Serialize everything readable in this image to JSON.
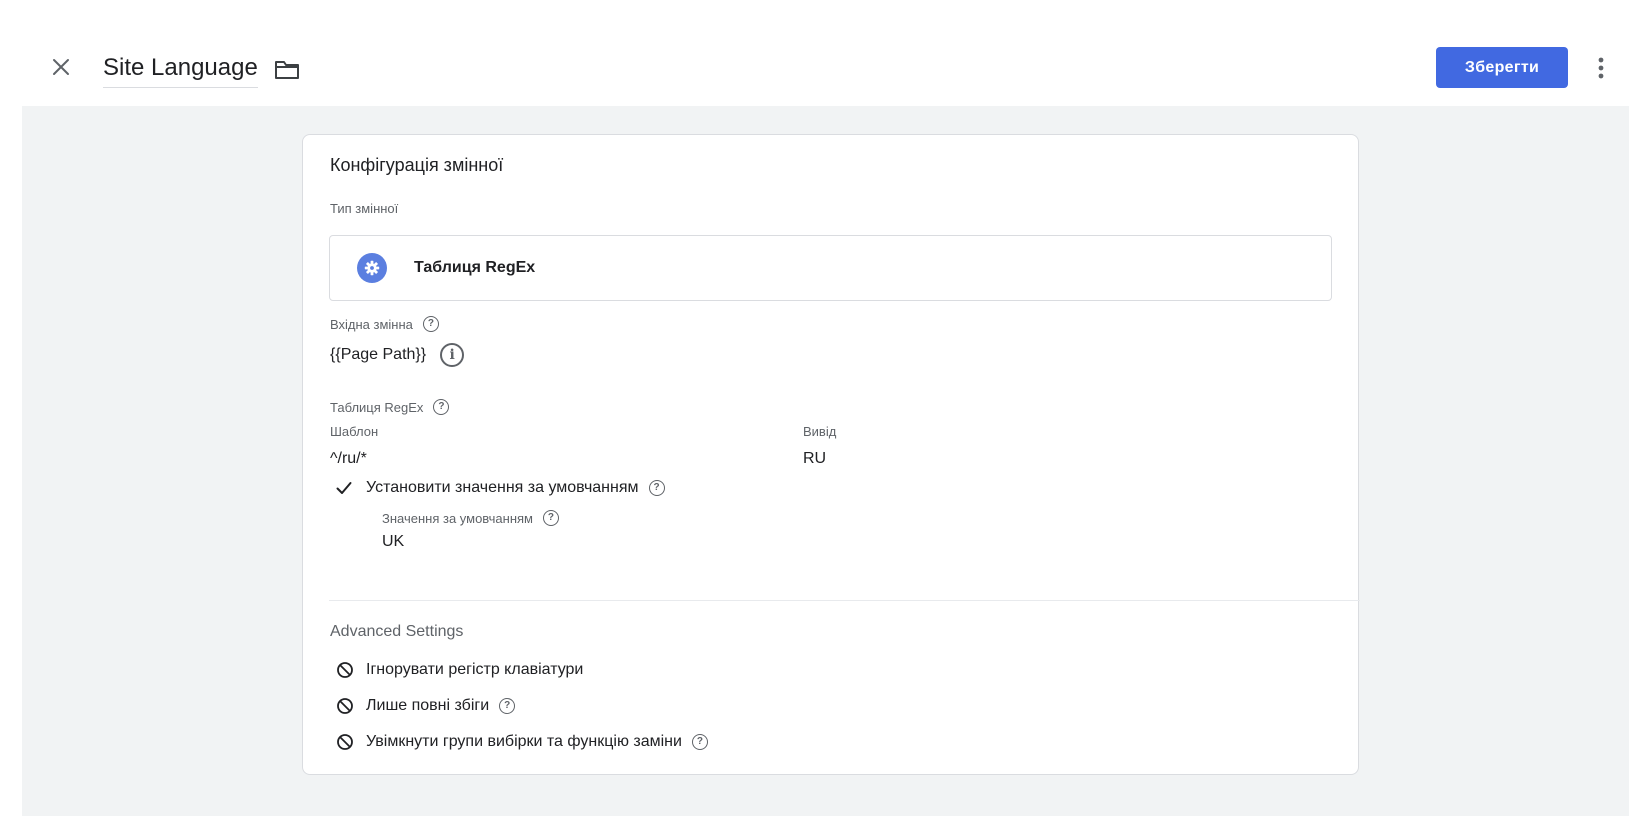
{
  "header": {
    "title": "Site Language",
    "save_label": "Зберегти"
  },
  "icons": {
    "close": "close-icon",
    "folder": "folder-icon",
    "more": "more-vert-icon",
    "type": "gear-icon",
    "help": "help-circle-icon",
    "info": "info-icon",
    "check": "check-icon",
    "disabled": "block-icon"
  },
  "colors": {
    "accent": "#4169e1",
    "type_icon": "#5b7fe0",
    "workspace_bg": "#f1f3f4"
  },
  "card": {
    "title": "Конфігурація змінної",
    "variable_type_label": "Тип змінної",
    "variable_type_value": "Таблиця RegEx",
    "input_variable_label": "Вхідна змінна",
    "input_variable_value": "{{Page Path}}",
    "regex_table_label": "Таблиця RegEx",
    "table": {
      "headers": {
        "pattern": "Шаблон",
        "output": "Вивід"
      },
      "rows": [
        {
          "pattern": "^/ru/*",
          "output": "RU"
        }
      ]
    },
    "default_option_label": "Установити значення за умовчанням",
    "default_value_label": "Значення за умовчанням",
    "default_value": "UK"
  },
  "advanced": {
    "title": "Advanced Settings",
    "options": [
      {
        "label": "Ігнорувати регістр клавіатури",
        "help": false
      },
      {
        "label": "Лише повні збіги",
        "help": true
      },
      {
        "label": "Увімкнути групи вибірки та функцію заміни",
        "help": true
      }
    ]
  }
}
